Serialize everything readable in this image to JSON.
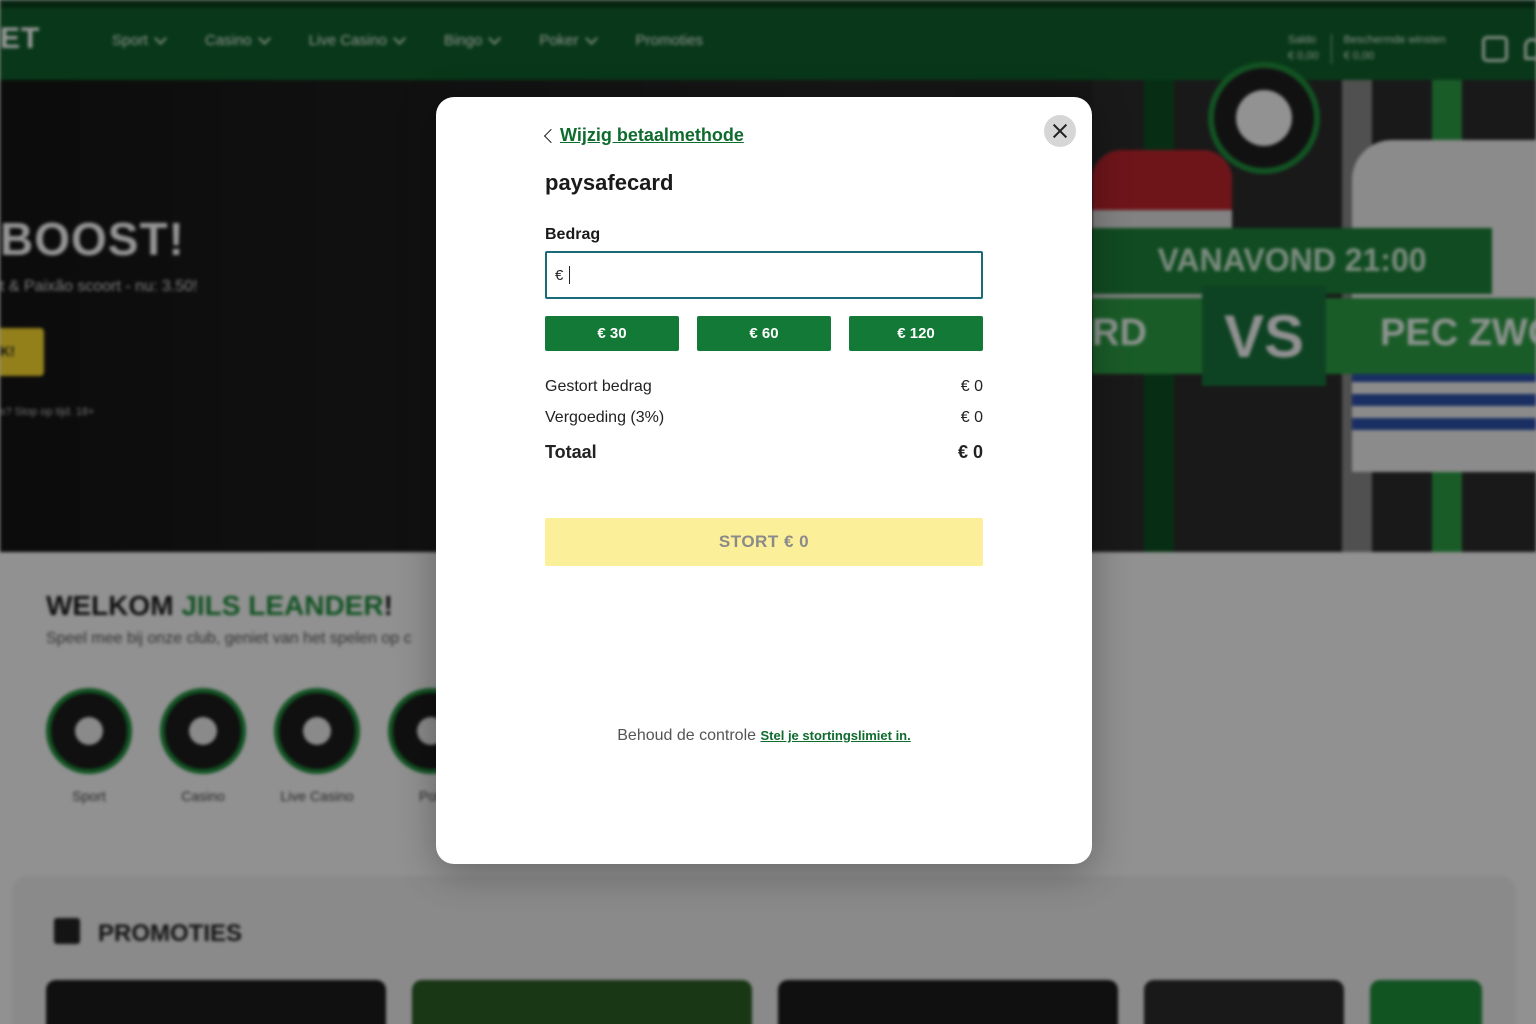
{
  "header": {
    "brand": "ET",
    "nav": [
      {
        "label": "Sport",
        "has_dropdown": true
      },
      {
        "label": "Casino",
        "has_dropdown": true
      },
      {
        "label": "Live Casino",
        "has_dropdown": true
      },
      {
        "label": "Bingo",
        "has_dropdown": true
      },
      {
        "label": "Poker",
        "has_dropdown": true
      },
      {
        "label": "Promoties",
        "has_dropdown": false
      }
    ],
    "balance_label": "Saldo",
    "balance_value": "€ 0,00",
    "protected_label": "Beschermde winsten",
    "protected_value": "€ 0,00"
  },
  "hero": {
    "title": "BOOST!",
    "subtitle": "t & Paixão scoort - nu: 3.50!",
    "button": "K!",
    "disclaimer": "s? Stop op tijd. 18+",
    "match_time": "VANAVOND 21:00",
    "team_left": "RD",
    "vs": "VS",
    "team_right": "PEC ZWO"
  },
  "welcome": {
    "prefix": "WELKOM ",
    "name": "JILS LEANDER",
    "suffix": "!",
    "subtitle": "Speel mee bij onze club, geniet van het spelen op c",
    "categories": [
      "Sport",
      "Casino",
      "Live Casino",
      "Pok"
    ]
  },
  "promotions": {
    "title": "PROMOTIES"
  },
  "modal": {
    "back_label": "Wijzig betaalmethode",
    "method": "paysafecard",
    "amount_label": "Bedrag",
    "currency_symbol": "€",
    "amount_value": "",
    "presets": [
      "€ 30",
      "€ 60",
      "€ 120"
    ],
    "summary": {
      "deposit_label": "Gestort bedrag",
      "deposit_value": "€ 0",
      "fee_label": "Vergoeding (3%)",
      "fee_value": "€ 0",
      "total_label": "Totaal",
      "total_value": "€ 0"
    },
    "submit_label": "STORT € 0",
    "footer_text": "Behoud de controle",
    "footer_link": "Stel je stortingslimiet in."
  },
  "colors": {
    "brand_green": "#127a36",
    "link_green": "#0f6b2e",
    "submit_disabled": "#fcef9a",
    "input_border": "#1a6b7a"
  }
}
